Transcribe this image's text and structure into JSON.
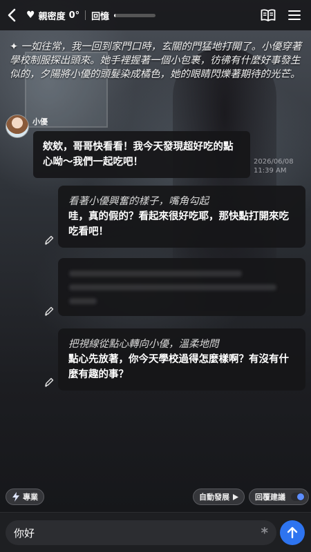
{
  "header": {
    "back_icon": "chevron-left-icon",
    "intimacy_icon": "heart-icon",
    "intimacy_label": "親密度",
    "intimacy_value": "0°",
    "memory_label": "回憶",
    "memory_progress": 0.03,
    "book_icon": "book-icon",
    "menu_icon": "menu-icon"
  },
  "narration": {
    "icon": "sparkle-icon",
    "text": "一如往常，我一回到家門口時，玄關的門猛地打開了。小優穿著學校制服探出頭來。她手裡握著一個小包裹，彷彿有什麼好事發生似的，夕陽將小優的頭髮染成橘色，她的眼睛閃爍著期待的光芒。"
  },
  "character": {
    "name": "小優",
    "message": "欸欸，哥哥快看看！我今天發現超好吃的點心呦～我們一起吃吧！",
    "timestamp_date": "2026/06/08",
    "timestamp_time": "11:39 AM"
  },
  "user_messages": [
    {
      "action": "看著小優興奮的樣子，嘴角勾起",
      "speech": "哇，真的假的？看起來很好吃耶，那快點打開來吃吃看吧！"
    },
    {
      "action": "把視線從點心轉向小優，溫柔地問",
      "speech": "點心先放著，你今天學校過得怎麼樣啊？有沒有什麼有趣的事？"
    }
  ],
  "controls": {
    "skill_icon": "lightning-icon",
    "skill_label": "專業",
    "auto_label": "自動發展",
    "auto_icon": "play-icon",
    "suggest_label": "回覆建議",
    "suggest_enabled": true
  },
  "composer": {
    "input_value": "你好",
    "send_icon": "arrow-up-icon"
  },
  "colors": {
    "accent": "#2e74f0",
    "toggle_on": "#5c8dff"
  }
}
